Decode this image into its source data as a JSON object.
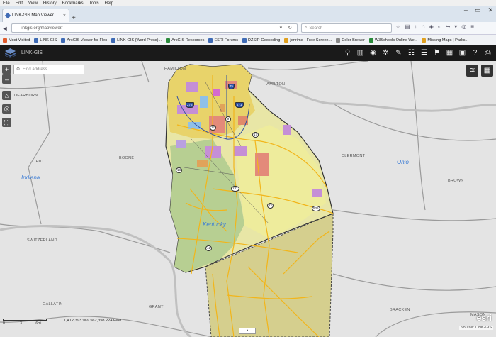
{
  "browser": {
    "menu": [
      "File",
      "Edit",
      "View",
      "History",
      "Bookmarks",
      "Tools",
      "Help"
    ],
    "tab_title": "LINK-GIS Map Viewer",
    "tab_close": "×",
    "new_tab": "+",
    "url": "linkgis.org/mapviewer/",
    "search_placeholder": "Search",
    "bookmarks": [
      {
        "label": "Most Visited",
        "color": "#e05a2b"
      },
      {
        "label": "LINK-GIS",
        "color": "#3f6bb5"
      },
      {
        "label": "ArcGIS Viewer for Flex",
        "color": "#3f6bb5"
      },
      {
        "label": "LINK-GIS (Word Press)...",
        "color": "#3f6bb5"
      },
      {
        "label": "ArcGIS Resources",
        "color": "#2a8a3b"
      },
      {
        "label": "ESRI Forums",
        "color": "#3f6bb5"
      },
      {
        "label": "DZSIP-Geocoding",
        "color": "#3f6bb5"
      },
      {
        "label": "jenrime - Free Screen...",
        "color": "#e0a020"
      },
      {
        "label": "Color Brewer",
        "color": "#888888"
      },
      {
        "label": "W3Schools Online We...",
        "color": "#2a8a3b"
      },
      {
        "label": "Missing Maps | Parks...",
        "color": "#e0a020"
      }
    ]
  },
  "app": {
    "title": "LINK-GIS",
    "address_placeholder": "Find address"
  },
  "map": {
    "labels": {
      "hamilton_top": "HAMILTON",
      "hamilton_right": "HAMILTON",
      "dearborn": "DEARBORN",
      "ohio_county": "OHIO",
      "boone": "BOONE",
      "clermont": "CLERMONT",
      "brown": "BROWN",
      "switzerland": "SWITZERLAND",
      "gallatin": "GALLATIN",
      "grant": "GRANT",
      "bracken": "BRACKEN",
      "mason": "MASON"
    },
    "states": {
      "indiana": "Indiana",
      "ohio": "Ohio",
      "kentucky": "Kentucky"
    },
    "highways": [
      "275",
      "75",
      "471",
      "9",
      "27",
      "536",
      "17",
      "18",
      "237",
      "42",
      "22"
    ],
    "scale_ticks": [
      "0",
      "3",
      "6mi"
    ],
    "coordinates": "1,412,393.969  562,398.224 Feet",
    "attribution": "Source: LINK-GIS",
    "esri": "esri"
  }
}
